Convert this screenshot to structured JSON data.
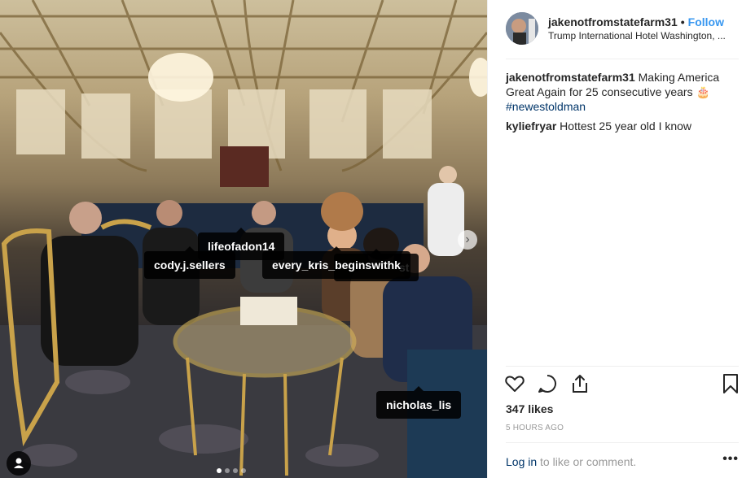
{
  "post": {
    "username": "jakenotfromstatefarm31",
    "follow_label": "Follow",
    "separator": "•",
    "location": "Trump International Hotel Washington, ...",
    "caption": {
      "username": "jakenotfromstatefarm31",
      "text": "Making America Great Again for 25 consecutive years 🎂",
      "hashtag": "#newestoldman"
    },
    "comments": [
      {
        "username": "kyliefryar",
        "text": "Hottest 25 year old I know"
      }
    ],
    "likes": "347 likes",
    "time_ago": "5 HOURS AGO",
    "login_link": "Log in",
    "login_suffix": "to like or comment.",
    "more_label": "•••"
  },
  "photo_tags": [
    {
      "label": "lifeofadon14"
    },
    {
      "label": "cody.j.sellers"
    },
    {
      "label": "every_kris_beginswithk"
    },
    {
      "label": "st"
    },
    {
      "label": "nicholas_lis"
    }
  ],
  "icons": [
    "heart-icon",
    "comment-icon",
    "share-icon",
    "bookmark-icon",
    "next-arrow-icon",
    "user-tag-icon"
  ],
  "colors": {
    "link": "#3897f0",
    "hashtag": "#003569",
    "muted": "#999999",
    "divider": "#efefef"
  }
}
